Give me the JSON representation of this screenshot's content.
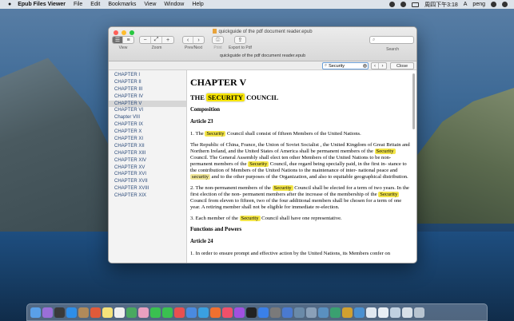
{
  "menubar": {
    "app_name": "Epub Files Viewer",
    "menus": [
      "File",
      "Edit",
      "Bookmarks",
      "View",
      "Window",
      "Help"
    ],
    "clock": "周四下午3:18",
    "user": "peng",
    "input_method": "A"
  },
  "window": {
    "title": "quickguide of the pdf document reader.epub",
    "path": "quickguide of the pdf document reader.epub",
    "toolbar": {
      "view_label": "View",
      "zoom_label": "Zoom",
      "prevnext_label": "Prev/Next",
      "print_label": "Print",
      "export_label": "Export to Pdf",
      "search_label": "Search",
      "zoom_out": "−",
      "zoom_fit": "⤢",
      "zoom_in": "+",
      "prev": "‹",
      "next": "›"
    },
    "find": {
      "value": "Security",
      "close_label": "Close",
      "prev": "‹",
      "next": "›"
    }
  },
  "sidebar": {
    "items": [
      "CHAPTER I",
      "CHAPTER II",
      "CHAPTER III",
      "CHAPTER IV",
      "CHAPTER V",
      "CHAPTER VI",
      "Chapter VIII",
      "CHAPTER IX",
      "CHAPTER X",
      "CHAPTER XI",
      "CHAPTER XII",
      "CHAPTER XIII",
      "CHAPTER XIV",
      "CHAPTER XV",
      "CHAPTER XVI",
      "CHAPTER XVII",
      "CHAPTER XVIII",
      "CHAPTER XIX"
    ],
    "selected_index": 4
  },
  "doc": {
    "chapter": "CHAPTER V",
    "heading_pre": "THE",
    "heading_hl": "SECURITY",
    "heading_post": "COUNCIL",
    "composition": "Composition",
    "article23": "Article 23",
    "p1_a": "1. The",
    "p1_hl": "Security",
    "p1_b": "Council shall consist of fifteen Members of the United Nations.",
    "p2_a": "The Republic of China, France, the Union of Soviet Socialist , the United Kingdom of Great Britain and Northern Ireland, and the United States of America shall be permanent members of the",
    "p2_hl1": "Security",
    "p2_b": "Council. The General Assembly shall elect ten other Members of the United Nations to be non-permanent members of the",
    "p2_hl2": "Security",
    "p2_c": "Council, due regard being specially paid, in the first in- stance to the contribution of Members of the United Nations to the maintenance of inter- national peace and",
    "p2_hl3": "security",
    "p2_d": "and to the other purposes of the Organization, and also to equitable geographical distribution.",
    "p3_a": "2. The non-permanent members of the",
    "p3_hl1": "Security",
    "p3_b": "Council shall be elected for a term of two years. In the first election of the non- permanent members after the increase of the membership of the",
    "p3_hl2": "Security",
    "p3_c": "Council from eleven to fifteen, two of the four additional members shall be chosen for a term of one year. A retiring member shall not be eligible for immediate re-election.",
    "p4_a": "3. Each member of the",
    "p4_hl": "Security",
    "p4_b": "Council shall have one representative.",
    "functions": "Functions and Powers",
    "article24": "Article 24",
    "p5": "1. In order to ensure prompt and effective action by the United Nations, its Members confer on"
  },
  "colors": {
    "highlight": "#f4e64a",
    "current_highlight": "#f8e600",
    "sidebar_text": "#2a4a7a"
  }
}
